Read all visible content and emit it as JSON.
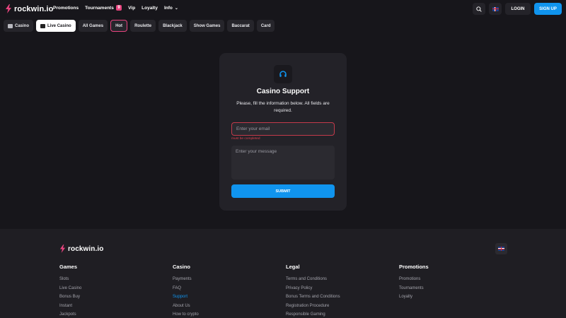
{
  "header": {
    "logo_text": "rockwin.io",
    "nav": [
      {
        "label": "Promotions"
      },
      {
        "label": "Tournaments",
        "badge": "9"
      },
      {
        "label": "Vip"
      },
      {
        "label": "Loyalty"
      },
      {
        "label": "Info"
      }
    ],
    "login_label": "LOGIN",
    "signup_label": "SIGN UP"
  },
  "categories": [
    {
      "label": "Casino",
      "active": false
    },
    {
      "label": "Live Casino",
      "active": true
    },
    {
      "label": "All Games",
      "active": false
    },
    {
      "label": "Hot",
      "active": false,
      "highlight": true
    },
    {
      "label": "Roulette",
      "active": false
    },
    {
      "label": "Blackjack",
      "active": false
    },
    {
      "label": "Show Games",
      "active": false
    },
    {
      "label": "Baccarat",
      "active": false
    },
    {
      "label": "Card",
      "active": false
    }
  ],
  "support": {
    "title": "Casino Support",
    "subtitle": "Please, fill the information below. All fields are required.",
    "email_placeholder": "Enter your email",
    "email_error": "must be completed",
    "message_placeholder": "Enter your message",
    "submit_label": "SUBMIT"
  },
  "footer": {
    "logo_text": "rockwin.io",
    "columns": [
      {
        "title": "Games",
        "links": [
          "Slots",
          "Live Casino",
          "Bonus Buy",
          "Instant",
          "Jackpots"
        ]
      },
      {
        "title": "Casino",
        "links": [
          "Payments",
          "FAQ",
          "Support",
          "About Us",
          "How to crypto"
        ]
      },
      {
        "title": "Legal",
        "links": [
          "Terms and Conditions",
          "Privacy Policy",
          "Bonus Terms and Conditions",
          "Registration Procedure",
          "Responsible Gaming"
        ]
      },
      {
        "title": "Promotions",
        "links": [
          "Promotions",
          "Tournaments",
          "Loyalty"
        ]
      }
    ]
  },
  "colors": {
    "accent": "#1094ee",
    "badge": "#e8447f",
    "error": "#e0404f",
    "background": "#17161b"
  }
}
